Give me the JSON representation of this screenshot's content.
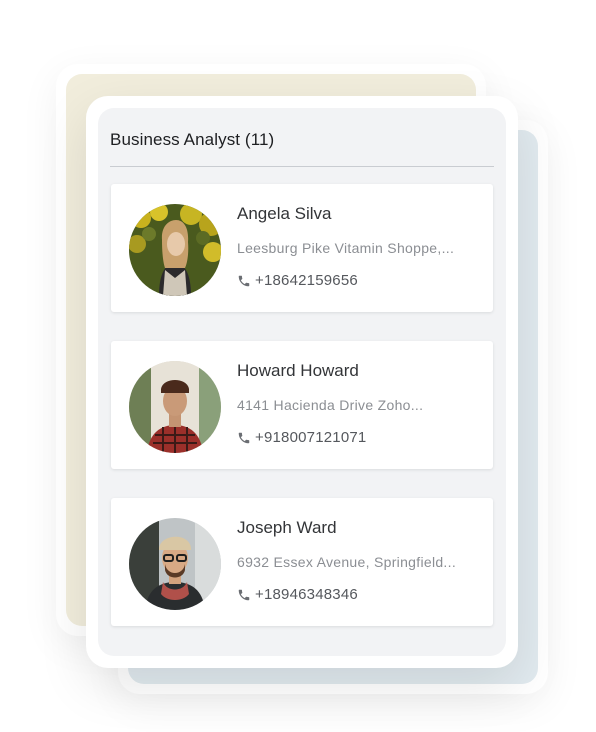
{
  "panel": {
    "title": "Business Analyst (11)"
  },
  "contacts": [
    {
      "name": "Angela Silva",
      "address": "Leesburg Pike Vitamin Shoppe,...",
      "phone": "+18642159656"
    },
    {
      "name": "Howard Howard",
      "address": "4141 Hacienda Drive Zoho...",
      "phone": "+918007121071"
    },
    {
      "name": "Joseph Ward",
      "address": "6932 Essex Avenue, Springfield...",
      "phone": "+18946348346"
    }
  ],
  "icons": {
    "phone": "phone-icon"
  },
  "colors": {
    "back_card_beige": "#f1eddc",
    "back_card_blue": "#e1eaef",
    "panel_bg": "#f2f3f5"
  }
}
